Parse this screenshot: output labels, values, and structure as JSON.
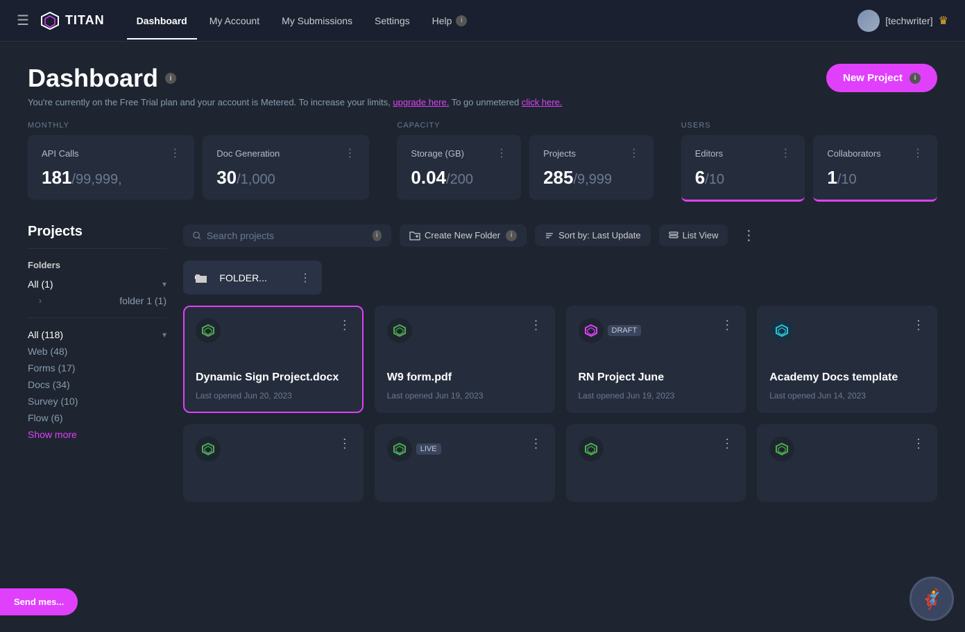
{
  "nav": {
    "logo_text": "TITAN",
    "hamburger_label": "☰",
    "links": [
      {
        "label": "Dashboard",
        "active": true
      },
      {
        "label": "My Account",
        "active": false
      },
      {
        "label": "My Submissions",
        "active": false
      },
      {
        "label": "Settings",
        "active": false
      },
      {
        "label": "Help",
        "active": false
      }
    ],
    "user_name": "[techwriter]",
    "crown": "♛"
  },
  "dashboard": {
    "title": "Dashboard",
    "info_badge": "i",
    "subtitle": "You're currently on the Free Trial plan and your account is Metered. To increase your limits,",
    "upgrade_link": "upgrade here.",
    "unmetered_text": "To go unmetered",
    "click_link": "click here.",
    "new_project_btn": "New Project"
  },
  "stats": {
    "monthly_label": "MONTHLY",
    "capacity_label": "CAPACITY",
    "users_label": "USERS",
    "cards": [
      {
        "name": "API Calls",
        "value": "181",
        "limit": "/99,999,",
        "accent": false
      },
      {
        "name": "Doc Generation",
        "value": "30",
        "limit": "/1,000",
        "accent": false
      },
      {
        "name": "Storage (GB)",
        "value": "0.04",
        "limit": "/200",
        "accent": false
      },
      {
        "name": "Projects",
        "value": "285",
        "limit": "/9,999",
        "accent": false
      },
      {
        "name": "Editors",
        "value": "6",
        "limit": "/10",
        "accent": true
      },
      {
        "name": "Collaborators",
        "value": "1",
        "limit": "/10",
        "accent": true
      }
    ]
  },
  "sidebar": {
    "title": "Projects",
    "folders_label": "Folders",
    "all_folders": "All (1)",
    "folder_children": [
      "folder 1 (1)"
    ],
    "categories_label": "All (118)",
    "categories": [
      "Web (48)",
      "Forms (17)",
      "Docs (34)",
      "Survey (10)",
      "Flow (6)"
    ],
    "show_more": "Show more"
  },
  "toolbar": {
    "search_placeholder": "Search projects",
    "create_folder": "Create New Folder",
    "sort_label": "Sort by: Last Update",
    "list_view": "List View"
  },
  "folder_item": {
    "name": "FOLDER...",
    "menu": "⋮"
  },
  "projects": [
    {
      "title": "Dynamic Sign Project.docx",
      "date": "Last opened Jun 20, 2023",
      "badge": "",
      "selected": true,
      "icon_color": "green"
    },
    {
      "title": "W9 form.pdf",
      "date": "Last opened Jun 19, 2023",
      "badge": "",
      "selected": false,
      "icon_color": "green"
    },
    {
      "title": "RN Project June",
      "date": "Last opened Jun 19, 2023",
      "badge": "DRAFT",
      "selected": false,
      "icon_color": "pink"
    },
    {
      "title": "Academy Docs template",
      "date": "Last opened Jun 14, 2023",
      "badge": "",
      "selected": false,
      "icon_color": "cyan"
    },
    {
      "title": "",
      "date": "",
      "badge": "",
      "selected": false,
      "icon_color": "green"
    },
    {
      "title": "",
      "date": "",
      "badge": "LIVE",
      "selected": false,
      "icon_color": "green"
    },
    {
      "title": "",
      "date": "",
      "badge": "",
      "selected": false,
      "icon_color": "green"
    },
    {
      "title": "",
      "date": "",
      "badge": "",
      "selected": false,
      "icon_color": "green"
    }
  ],
  "send_message_btn": "Send mes...",
  "bot_avatar": "🦸"
}
